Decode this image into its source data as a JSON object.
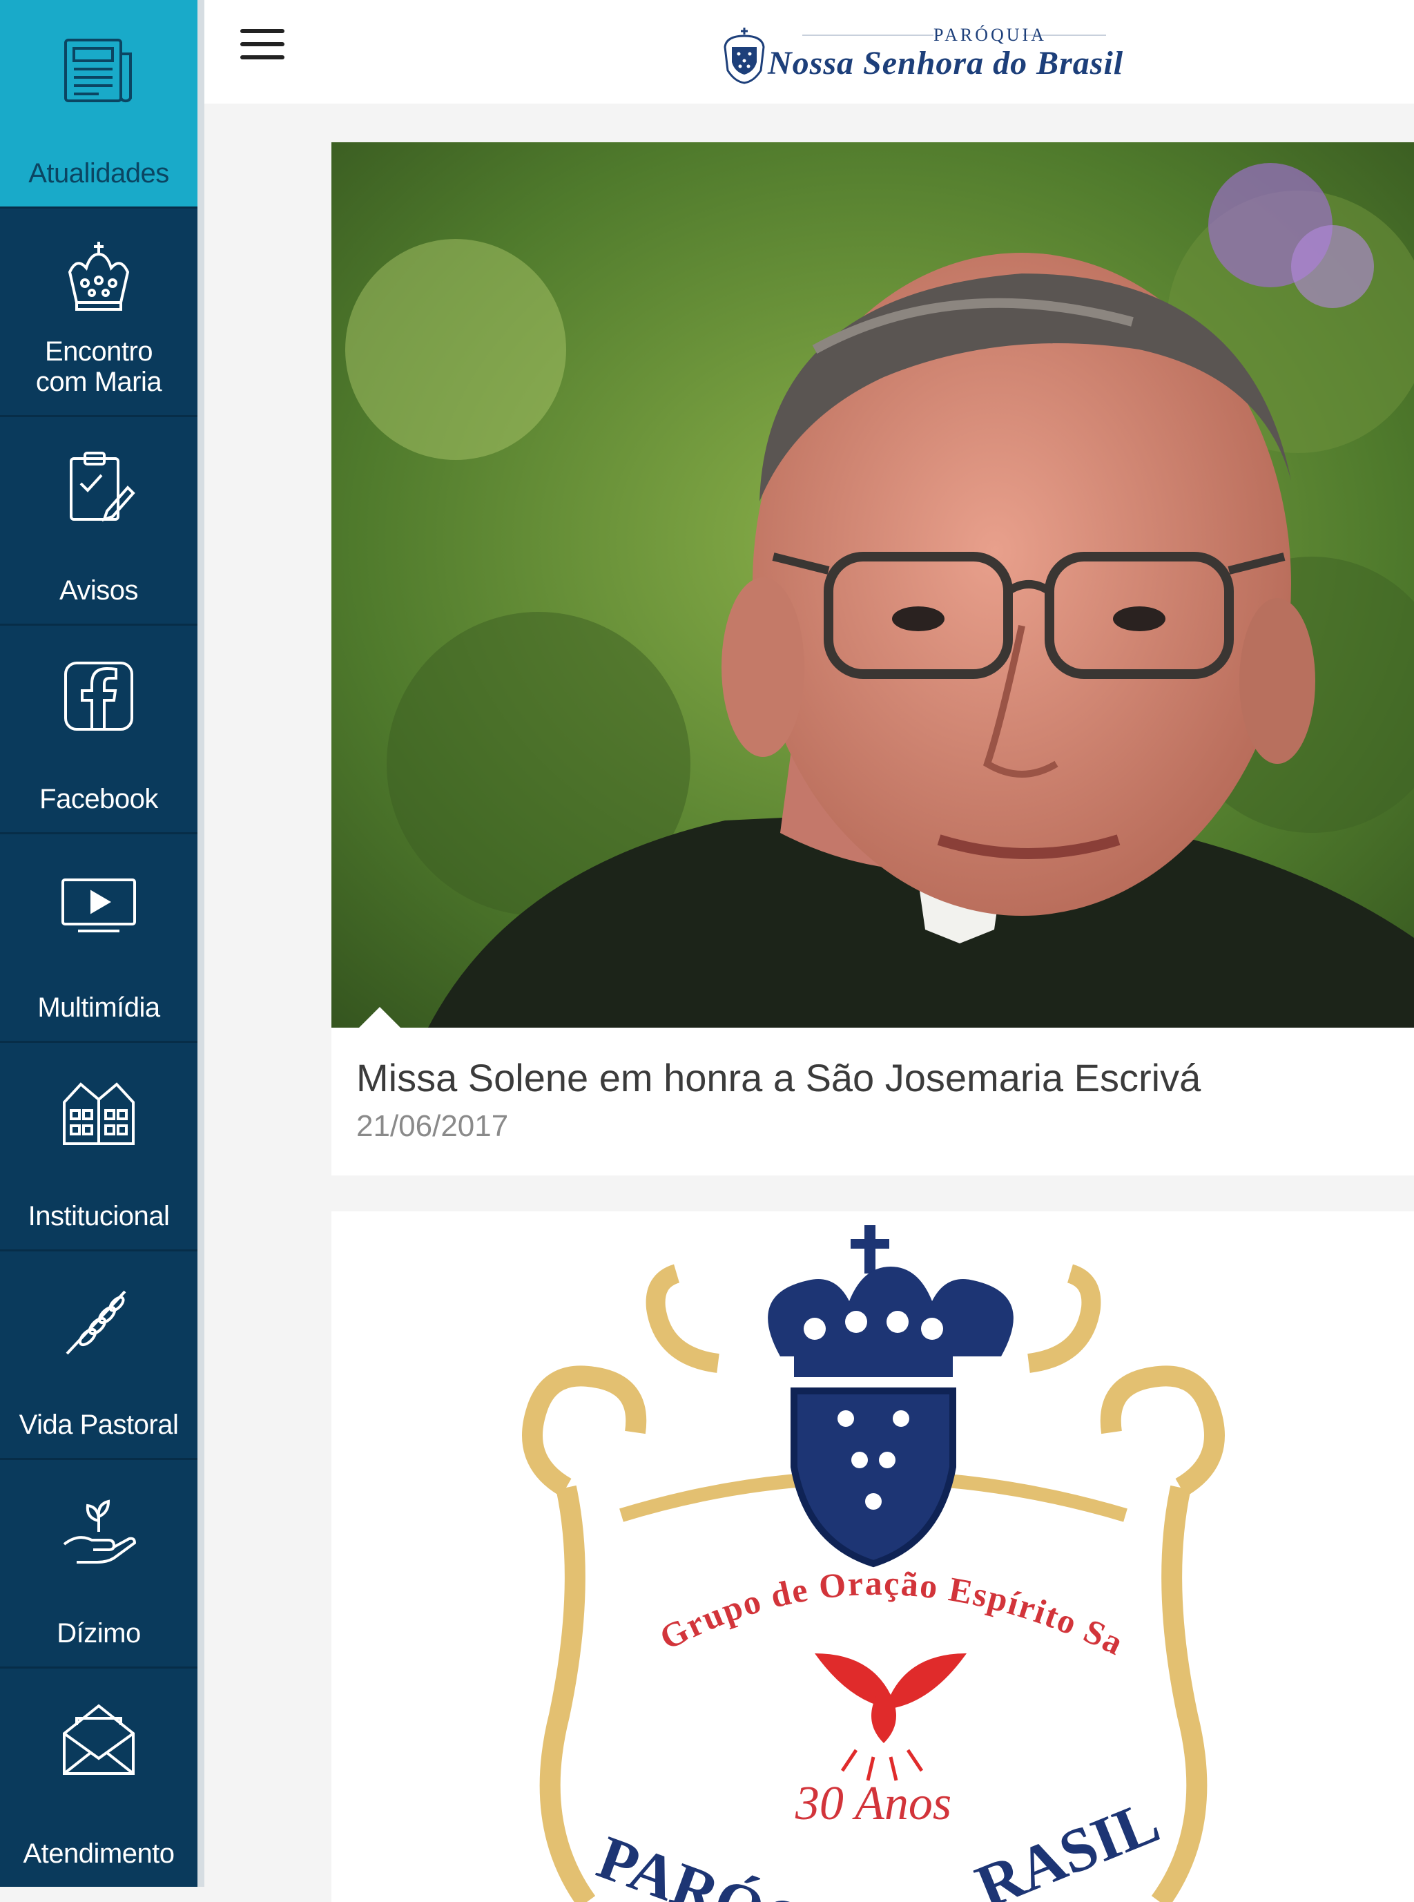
{
  "sidebar": {
    "items": [
      {
        "label": "Atualidades",
        "icon": "newspaper-icon",
        "active": true
      },
      {
        "label": "Encontro com Maria",
        "icon": "crown-icon"
      },
      {
        "label": "Avisos",
        "icon": "clipboard-check-icon"
      },
      {
        "label": "Facebook",
        "icon": "facebook-icon"
      },
      {
        "label": "Multimídia",
        "icon": "video-screen-icon"
      },
      {
        "label": "Institucional",
        "icon": "church-building-icon"
      },
      {
        "label": "Vida Pastoral",
        "icon": "wheat-icon"
      },
      {
        "label": "Dízimo",
        "icon": "hand-plant-icon"
      },
      {
        "label": "Atendimento",
        "icon": "envelope-icon"
      }
    ],
    "colors": {
      "background": "#0a3a5c",
      "active": "#19aac9"
    }
  },
  "header": {
    "menu_icon": "hamburger-menu-icon",
    "logo": {
      "subtitle": "PARÓQUIA",
      "title": "Nossa Senhora do Brasil"
    }
  },
  "feed": {
    "cards": [
      {
        "title": "Missa Solene em honra a São Josemaria Escrivá",
        "date": "21/06/2017",
        "image": "portrait of a priest with glasses"
      },
      {
        "image": "parish emblem with crown",
        "emblem_text_top": "Grupo de Oração Espírito Santo",
        "emblem_anniversary": "30 Anos",
        "emblem_text_bottom_left": "PARÓQ",
        "emblem_text_bottom_right": "RASIL"
      }
    ]
  }
}
